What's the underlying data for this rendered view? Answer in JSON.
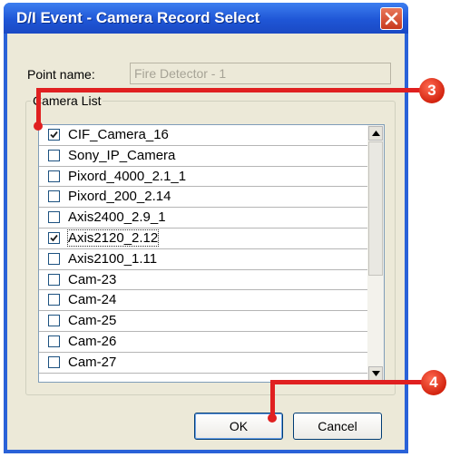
{
  "window": {
    "title": "D/I Event - Camera Record Select"
  },
  "point": {
    "label": "Point name:",
    "value": "Fire Detector - 1"
  },
  "camera_group": {
    "label": "Camera List"
  },
  "cameras": [
    {
      "name": "CIF_Camera_16",
      "checked": true
    },
    {
      "name": "Sony_IP_Camera",
      "checked": false
    },
    {
      "name": "Pixord_4000_2.1_1",
      "checked": false
    },
    {
      "name": "Pixord_200_2.14",
      "checked": false
    },
    {
      "name": "Axis2400_2.9_1",
      "checked": false
    },
    {
      "name": "Axis2120_2.12",
      "checked": true,
      "focused": true
    },
    {
      "name": "Axis2100_1.11",
      "checked": false
    },
    {
      "name": "Cam-23",
      "checked": false
    },
    {
      "name": "Cam-24",
      "checked": false
    },
    {
      "name": "Cam-25",
      "checked": false
    },
    {
      "name": "Cam-26",
      "checked": false
    },
    {
      "name": "Cam-27",
      "checked": false
    }
  ],
  "buttons": {
    "ok": "OK",
    "cancel": "Cancel"
  },
  "callouts": {
    "camera_list": "3",
    "ok_button": "4"
  },
  "colors": {
    "titlebar": "#1f56d6",
    "callout": "#e02020",
    "dialog_bg": "#ece9d8"
  }
}
